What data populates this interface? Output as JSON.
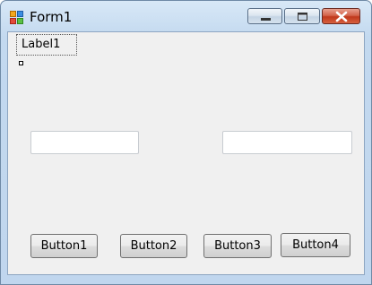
{
  "window": {
    "title": "Form1"
  },
  "titlebar": {
    "minimize_icon": "minimize-icon",
    "maximize_icon": "maximize-icon",
    "close_icon": "close-icon"
  },
  "form": {
    "label1": "Label1",
    "textbox1": {
      "value": ""
    },
    "textbox2": {
      "value": ""
    },
    "buttons": [
      "Button1",
      "Button2",
      "Button3",
      "Button4"
    ]
  },
  "colors": {
    "frame": "#c0d6ee",
    "client": "#f0f0f0",
    "close": "#c0391c"
  }
}
